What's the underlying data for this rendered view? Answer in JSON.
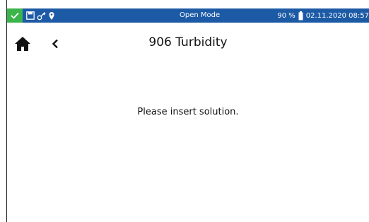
{
  "status_bar": {
    "mode": "Open Mode",
    "battery": "90 %",
    "datetime": "02.11.2020 08:57",
    "colors": {
      "bar": "#1d5aa6",
      "ok": "#3bb44a"
    },
    "icons": [
      "check-icon",
      "save-icon",
      "key-icon",
      "location-pin-icon",
      "battery-icon"
    ]
  },
  "nav": {
    "icons": [
      "home-icon",
      "chevron-left-icon"
    ]
  },
  "page": {
    "title": "906 Turbidity",
    "message": "Please insert solution."
  }
}
